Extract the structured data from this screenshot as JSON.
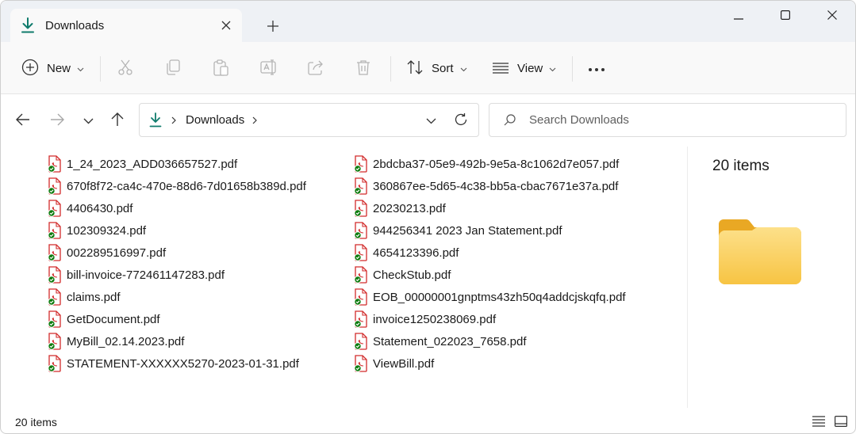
{
  "tab": {
    "title": "Downloads",
    "icon": "download-arrow-icon"
  },
  "window_controls": {
    "minimize_icon": "minimize-icon",
    "maximize_icon": "maximize-icon",
    "close_icon": "close-icon"
  },
  "toolbar": {
    "new_label": "New",
    "sort_label": "Sort",
    "view_label": "View",
    "icons": [
      "new-plus-icon",
      "cut-icon",
      "copy-icon",
      "paste-icon",
      "rename-icon",
      "share-icon",
      "delete-icon",
      "sort-icon",
      "view-icon",
      "more-icon"
    ]
  },
  "address": {
    "breadcrumb": [
      "Downloads"
    ],
    "folder_icon": "download-arrow-icon"
  },
  "search": {
    "placeholder": "Search Downloads",
    "value": ""
  },
  "files": {
    "column1": [
      "1_24_2023_ADD036657527.pdf",
      "670f8f72-ca4c-470e-88d6-7d01658b389d.pdf",
      "4406430.pdf",
      "102309324.pdf",
      "002289516997.pdf",
      "bill-invoice-772461147283.pdf",
      "claims.pdf",
      "GetDocument.pdf",
      "MyBill_02.14.2023.pdf",
      "STATEMENT-XXXXXX5270-2023-01-31.pdf"
    ],
    "column2": [
      "2bdcba37-05e9-492b-9e5a-8c1062d7e057.pdf",
      "360867ee-5d65-4c38-bb5a-cbac7671e37a.pdf",
      "20230213.pdf",
      "944256341 2023 Jan Statement.pdf",
      "4654123396.pdf",
      "CheckStub.pdf",
      "EOB_00000001gnptms43zh50q4addcjskqfq.pdf",
      "invoice1250238069.pdf",
      "Statement_022023_7658.pdf",
      "ViewBill.pdf"
    ],
    "file_icon": "pdf-file-synced-icon"
  },
  "details": {
    "count": "20 items",
    "icon": "folder-icon"
  },
  "status": {
    "count": "20 items"
  },
  "colors": {
    "accent": "#0f7b6c",
    "pdf_red": "#d22b2b",
    "sync_green": "#107c10",
    "folder_yellow": "#f6c244"
  }
}
